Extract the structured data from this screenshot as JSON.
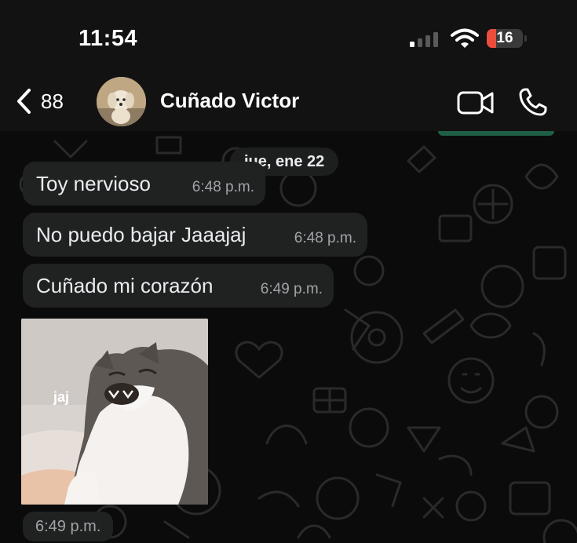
{
  "status_bar": {
    "time": "11:54",
    "battery": "16",
    "battery_fraction": 0.16,
    "icons": [
      "cellular-signal-icon",
      "wifi-icon",
      "battery-icon"
    ]
  },
  "header": {
    "back_count": "88",
    "contact_name": "Cuñado Victor",
    "icons": [
      "chevron-left-icon",
      "video-camera-icon",
      "phone-icon"
    ]
  },
  "chat": {
    "date_label": "jue, ene 22",
    "messages": [
      {
        "text": "Toy nervioso",
        "time": "6:48 p.m."
      },
      {
        "text": "No puedo bajar Jaaajaj",
        "time": "6:48 p.m."
      },
      {
        "text": "Cuñado mi corazón",
        "time": "6:49 p.m."
      }
    ],
    "image_message": {
      "caption": "jaj",
      "time": "6:49 p.m."
    }
  },
  "colors": {
    "background": "#0b0b0b",
    "bar": "#121212",
    "bubble": "#202222",
    "time_text": "#9fa4a7",
    "battery_low": "#eb4d3d",
    "accent_green": "#1f5f45"
  }
}
